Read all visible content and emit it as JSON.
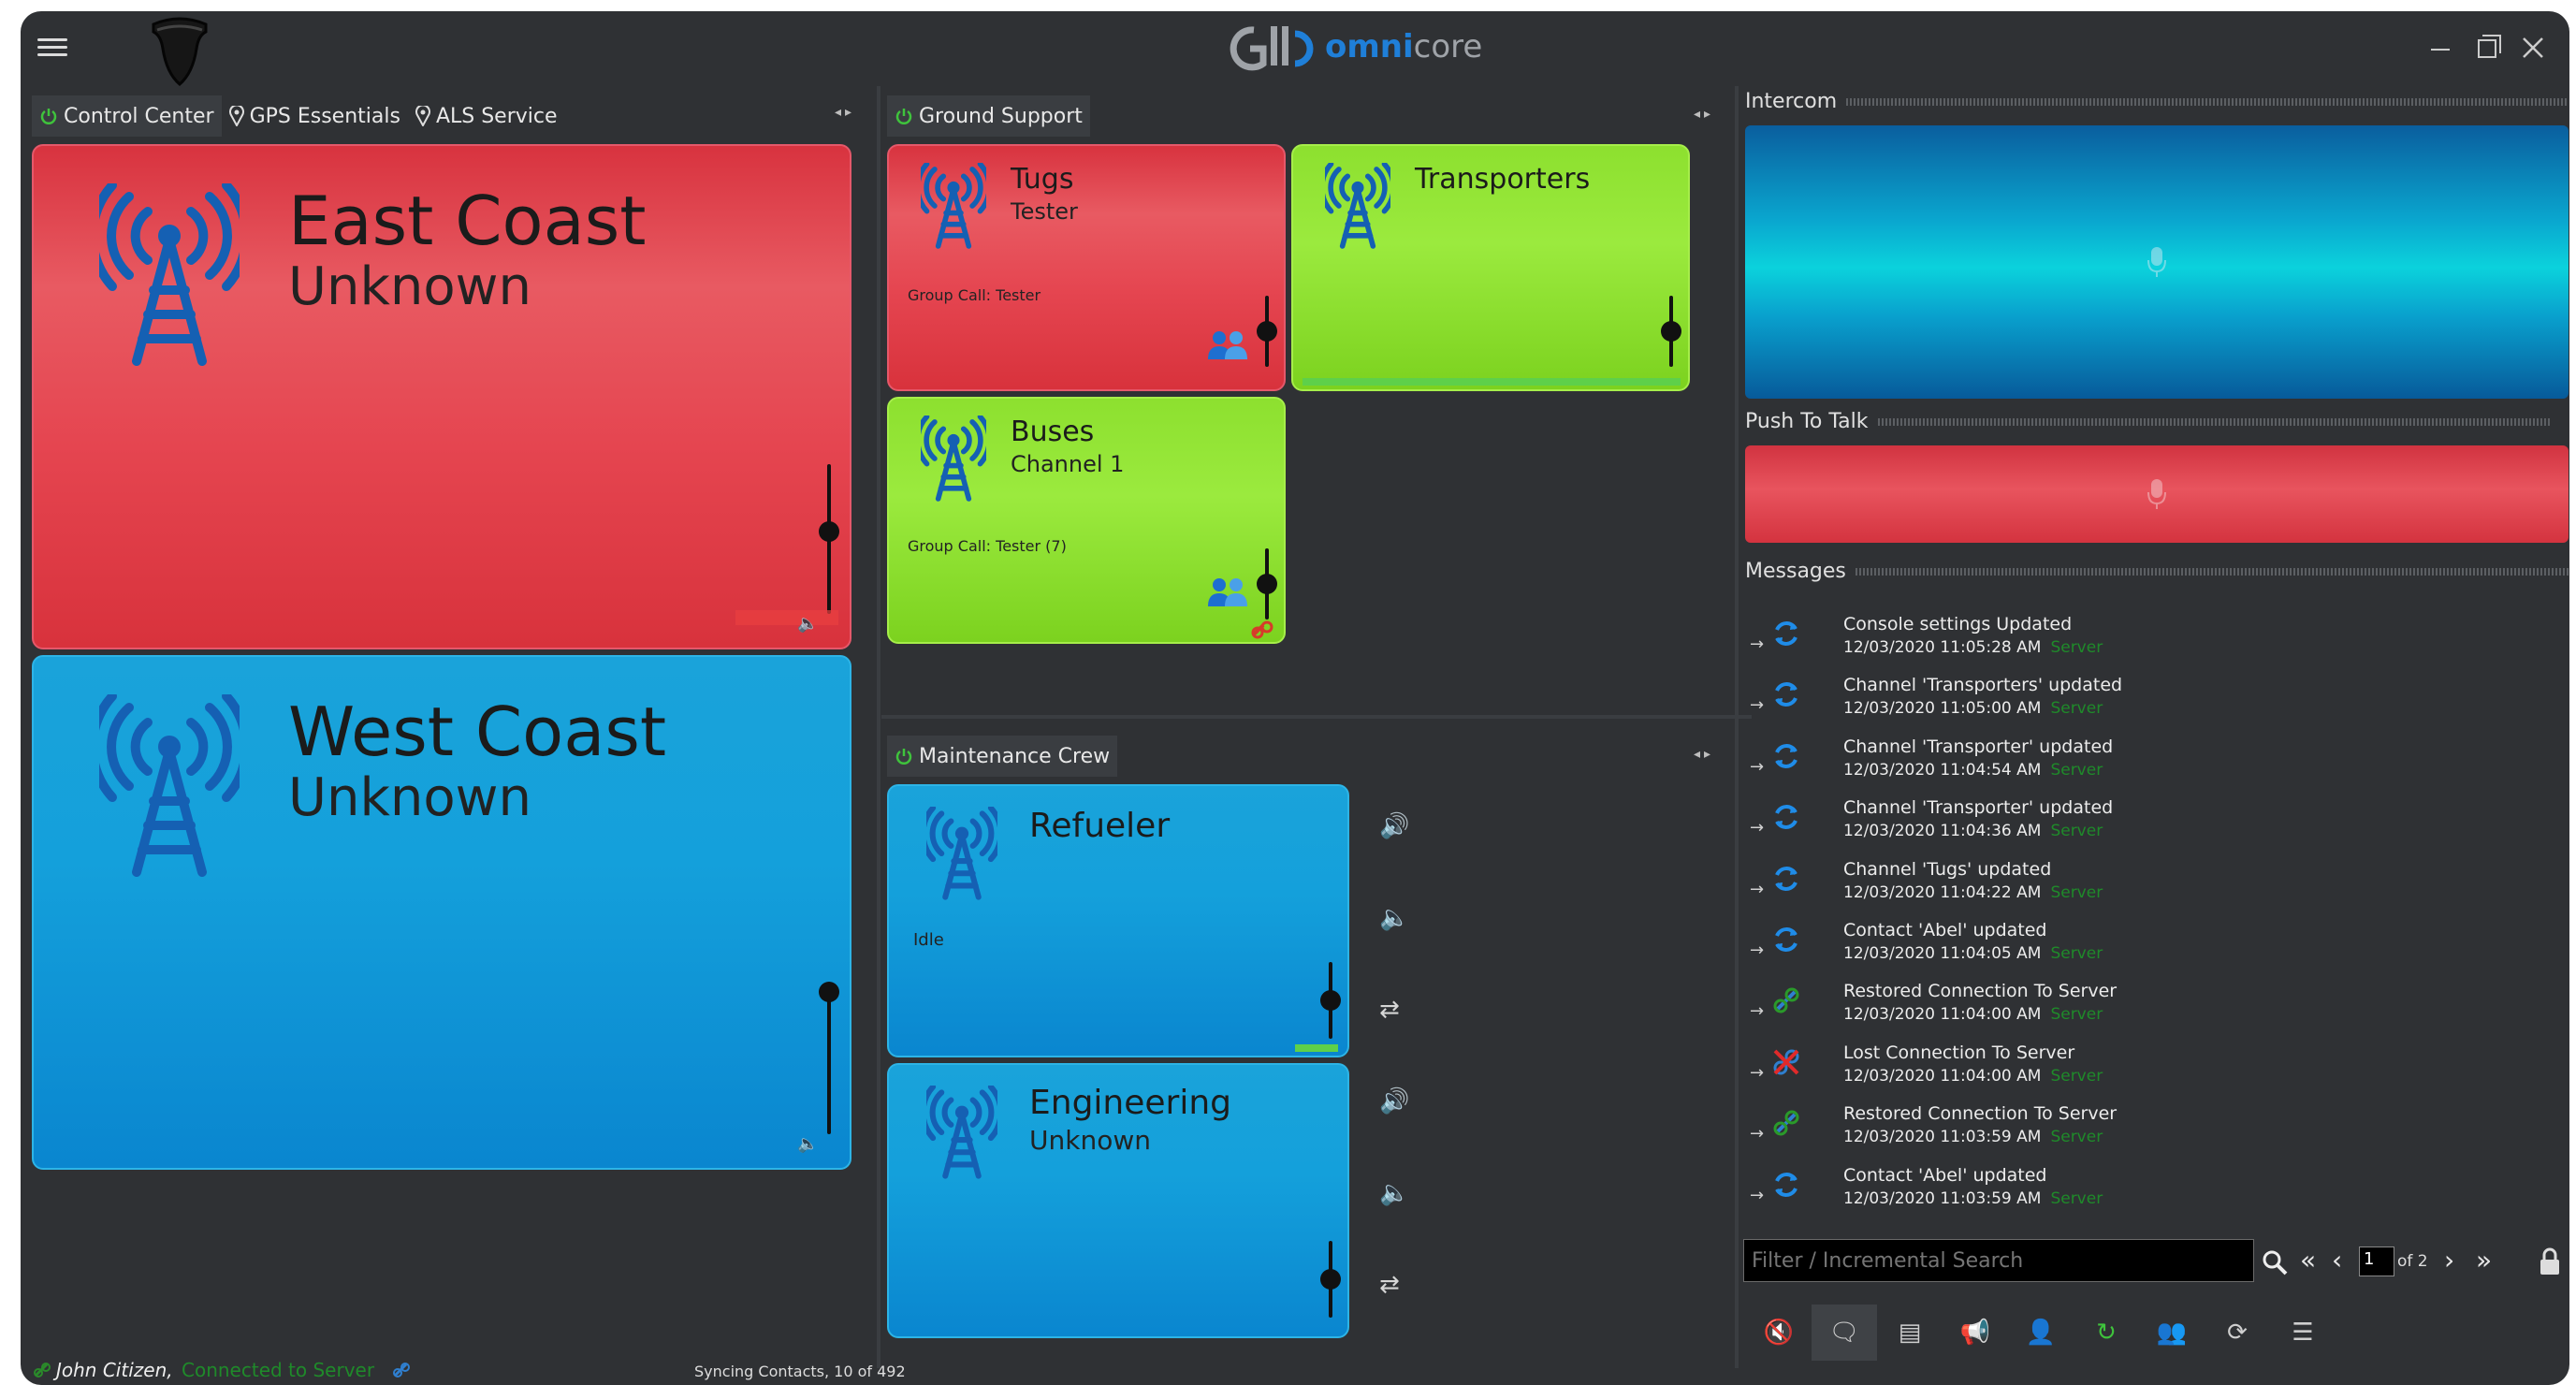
{
  "app": {
    "logo_text_a": "omni",
    "logo_text_b": "core"
  },
  "colors": {
    "red": "#d8333f",
    "green": "#8de02f",
    "blue": "#14a0db",
    "server": "#1f8a2a",
    "accent": "#1f7fd8"
  },
  "left_pane": {
    "tabs": [
      {
        "label": "Control Center",
        "icon": "power-icon"
      },
      {
        "label": "GPS Essentials",
        "icon": "map-pin-icon"
      },
      {
        "label": "ALS Service",
        "icon": "map-pin-icon"
      }
    ],
    "cards": [
      {
        "name": "East Coast",
        "status": "Unknown",
        "color": "red",
        "volume": 0.55
      },
      {
        "name": "West Coast",
        "status": "Unknown",
        "color": "blue",
        "volume": 0.95
      }
    ]
  },
  "ground_support": {
    "title": "Ground Support",
    "cards": [
      {
        "name": "Tugs",
        "status": "Tester",
        "detail": "Group Call: Tester",
        "color": "red",
        "volume": 0.5
      },
      {
        "name": "Transporters",
        "status": "",
        "detail": "",
        "color": "green",
        "volume": 0.5
      },
      {
        "name": "Buses",
        "status": "Channel 1",
        "detail": "Group Call: Tester  (7)",
        "color": "green",
        "volume": 0.5
      }
    ]
  },
  "maintenance_crew": {
    "title": "Maintenance Crew",
    "cards": [
      {
        "name": "Refueler",
        "status": "",
        "detail": "Idle",
        "color": "blue",
        "volume": 0.5
      },
      {
        "name": "Engineering",
        "status": "Unknown",
        "detail": "",
        "color": "blue",
        "volume": 0.5
      }
    ]
  },
  "intercom": {
    "title": "Intercom"
  },
  "push_to_talk": {
    "title": "Push To Talk"
  },
  "messages": {
    "title": "Messages",
    "items": [
      {
        "text": "Console settings Updated",
        "time": "12/03/2020 11:05:28 AM",
        "source": "Server",
        "icon": "refresh-icon"
      },
      {
        "text": "Channel 'Transporters' updated",
        "time": "12/03/2020 11:05:00 AM",
        "source": "Server",
        "icon": "refresh-icon"
      },
      {
        "text": "Channel 'Transporter' updated",
        "time": "12/03/2020 11:04:54 AM",
        "source": "Server",
        "icon": "refresh-icon"
      },
      {
        "text": "Channel 'Transporter' updated",
        "time": "12/03/2020 11:04:36 AM",
        "source": "Server",
        "icon": "refresh-icon"
      },
      {
        "text": "Channel 'Tugs' updated",
        "time": "12/03/2020 11:04:22 AM",
        "source": "Server",
        "icon": "refresh-icon"
      },
      {
        "text": "Contact 'Abel' updated",
        "time": "12/03/2020 11:04:05 AM",
        "source": "Server",
        "icon": "refresh-icon"
      },
      {
        "text": "Restored Connection To Server",
        "time": "12/03/2020 11:04:00 AM",
        "source": "Server",
        "icon": "link-icon"
      },
      {
        "text": "Lost Connection To Server",
        "time": "12/03/2020 11:04:00 AM",
        "source": "Server",
        "icon": "broken-link-icon"
      },
      {
        "text": "Restored Connection To Server",
        "time": "12/03/2020 11:03:59 AM",
        "source": "Server",
        "icon": "link-icon"
      },
      {
        "text": "Contact 'Abel' updated",
        "time": "12/03/2020 11:03:59 AM",
        "source": "Server",
        "icon": "refresh-icon"
      }
    ],
    "search_placeholder": "Filter / Incremental Search",
    "page": "1",
    "page_of": "of 2"
  },
  "toolbar": {
    "buttons": [
      "speaker-muted-icon",
      "chat-icon",
      "keyboard-icon",
      "megaphone-icon",
      "user-icon",
      "refresh-icon",
      "group-icon",
      "redial-icon",
      "list-icon"
    ]
  },
  "status_bar": {
    "user": "John Citizen,",
    "connection": "Connected to Server",
    "sync": "Syncing Contacts, 10 of 492"
  }
}
